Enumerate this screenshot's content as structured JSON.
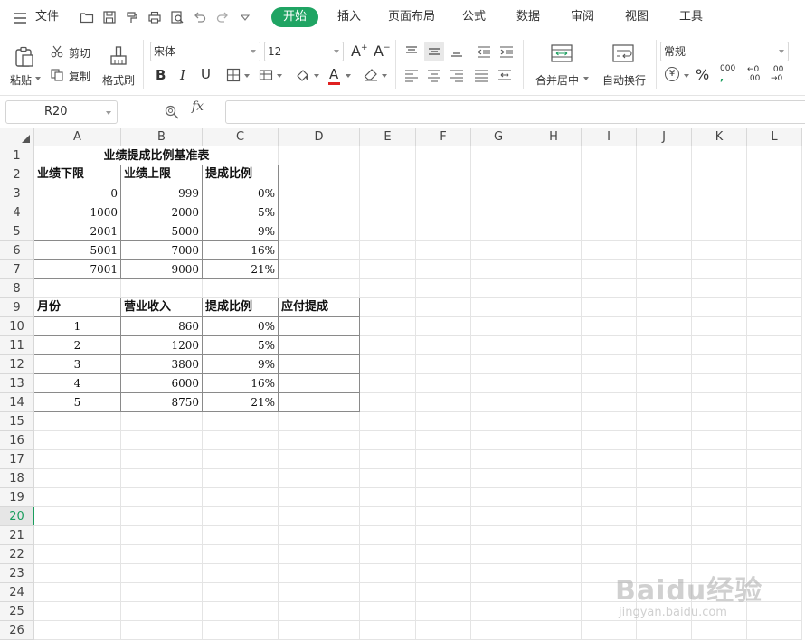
{
  "menubar": {
    "file_label": "文件",
    "tabs": [
      {
        "label": "开始"
      },
      {
        "label": "插入"
      },
      {
        "label": "页面布局"
      },
      {
        "label": "公式"
      },
      {
        "label": "数据"
      },
      {
        "label": "审阅"
      },
      {
        "label": "视图"
      },
      {
        "label": "工具"
      }
    ],
    "active_tab": "开始",
    "accent_color": "#1fa463"
  },
  "ribbon": {
    "paste_label": "粘贴",
    "cut_label": "剪切",
    "copy_label": "复制",
    "format_painter_label": "格式刷",
    "font_name": "宋体",
    "font_size": "12",
    "merge_center_label": "合并居中",
    "wrap_text_label": "自动换行",
    "number_format": "常规",
    "percent_symbol": "%",
    "currency_symbol": "¥",
    "thousands_label": "000",
    "increase_decimal_top": "←0",
    "increase_decimal_bottom": ".00",
    "decrease_decimal_top": ".00",
    "decrease_decimal_bottom": "→0",
    "bold_label": "B",
    "italic_label": "I",
    "underline_label": "U",
    "font_color_label": "A",
    "grow_font_label": "A",
    "shrink_font_label": "A"
  },
  "formula_bar": {
    "name_box": "R20",
    "fx_label": "fx",
    "formula": ""
  },
  "sheet": {
    "columns": [
      "A",
      "B",
      "C",
      "D",
      "E",
      "F",
      "G",
      "H",
      "I",
      "J",
      "K",
      "L"
    ],
    "rows": [
      "1",
      "2",
      "3",
      "4",
      "5",
      "6",
      "7",
      "8",
      "9",
      "10",
      "11",
      "12",
      "13",
      "14",
      "15",
      "16",
      "17",
      "18",
      "19",
      "20",
      "21",
      "22",
      "23",
      "24",
      "25",
      "26"
    ],
    "active_row": "20",
    "title": "业绩提成比例基准表",
    "table1_headers": [
      "业绩下限",
      "业绩上限",
      "提成比例"
    ],
    "table1_rows": [
      [
        "0",
        "999",
        "0%"
      ],
      [
        "1000",
        "2000",
        "5%"
      ],
      [
        "2001",
        "5000",
        "9%"
      ],
      [
        "5001",
        "7000",
        "16%"
      ],
      [
        "7001",
        "9000",
        "21%"
      ]
    ],
    "table2_headers": [
      "月份",
      "营业收入",
      "提成比例",
      "应付提成"
    ],
    "table2_rows": [
      [
        "1",
        "860",
        "0%",
        ""
      ],
      [
        "2",
        "1200",
        "5%",
        ""
      ],
      [
        "3",
        "3800",
        "9%",
        ""
      ],
      [
        "4",
        "6000",
        "16%",
        ""
      ],
      [
        "5",
        "8750",
        "21%",
        ""
      ]
    ]
  },
  "watermark": {
    "brand": "Baidu经验",
    "url": "jingyan.baidu.com"
  }
}
